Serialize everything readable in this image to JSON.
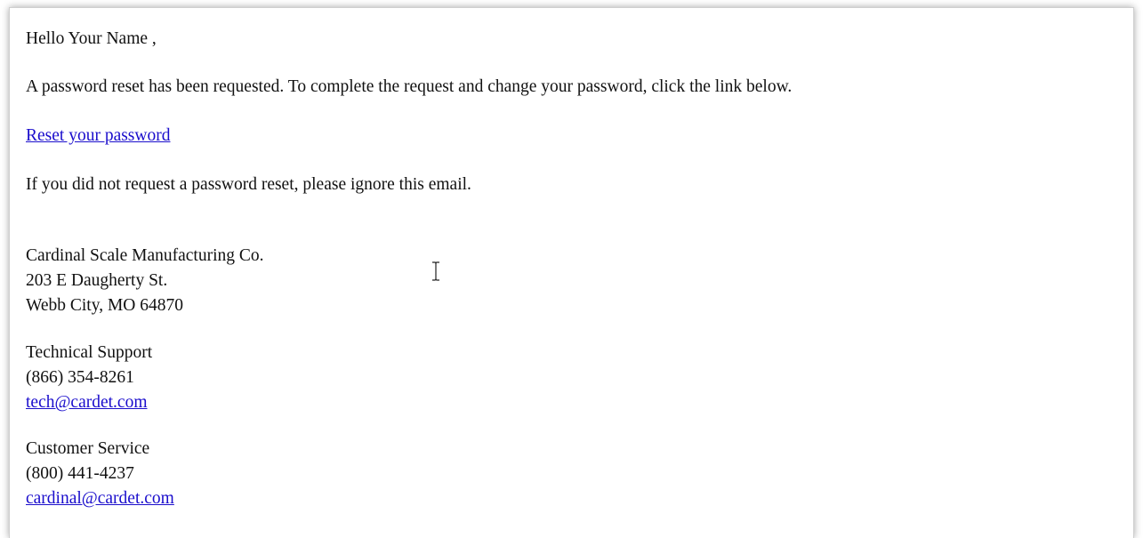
{
  "email": {
    "greeting": "Hello Your Name ,",
    "intro": "A password reset has been requested. To complete the request and change your password, click the link below.",
    "reset_link": "Reset your password",
    "ignore_note": "If you did not request a password reset, please ignore this email."
  },
  "signature": {
    "company": "Cardinal Scale Manufacturing Co.",
    "street": "203 E Daugherty St.",
    "city": "Webb City, MO 64870",
    "tech": {
      "label": "Technical Support",
      "phone": "(866) 354-8261",
      "email": "tech@cardet.com"
    },
    "customer_service": {
      "label": "Customer Service",
      "phone": "(800) 441-4237",
      "email": "cardinal@cardet.com"
    }
  },
  "colors": {
    "link": "#1a0dcc",
    "text": "#111111"
  },
  "icons": {
    "cursor": "text-cursor-icon"
  }
}
